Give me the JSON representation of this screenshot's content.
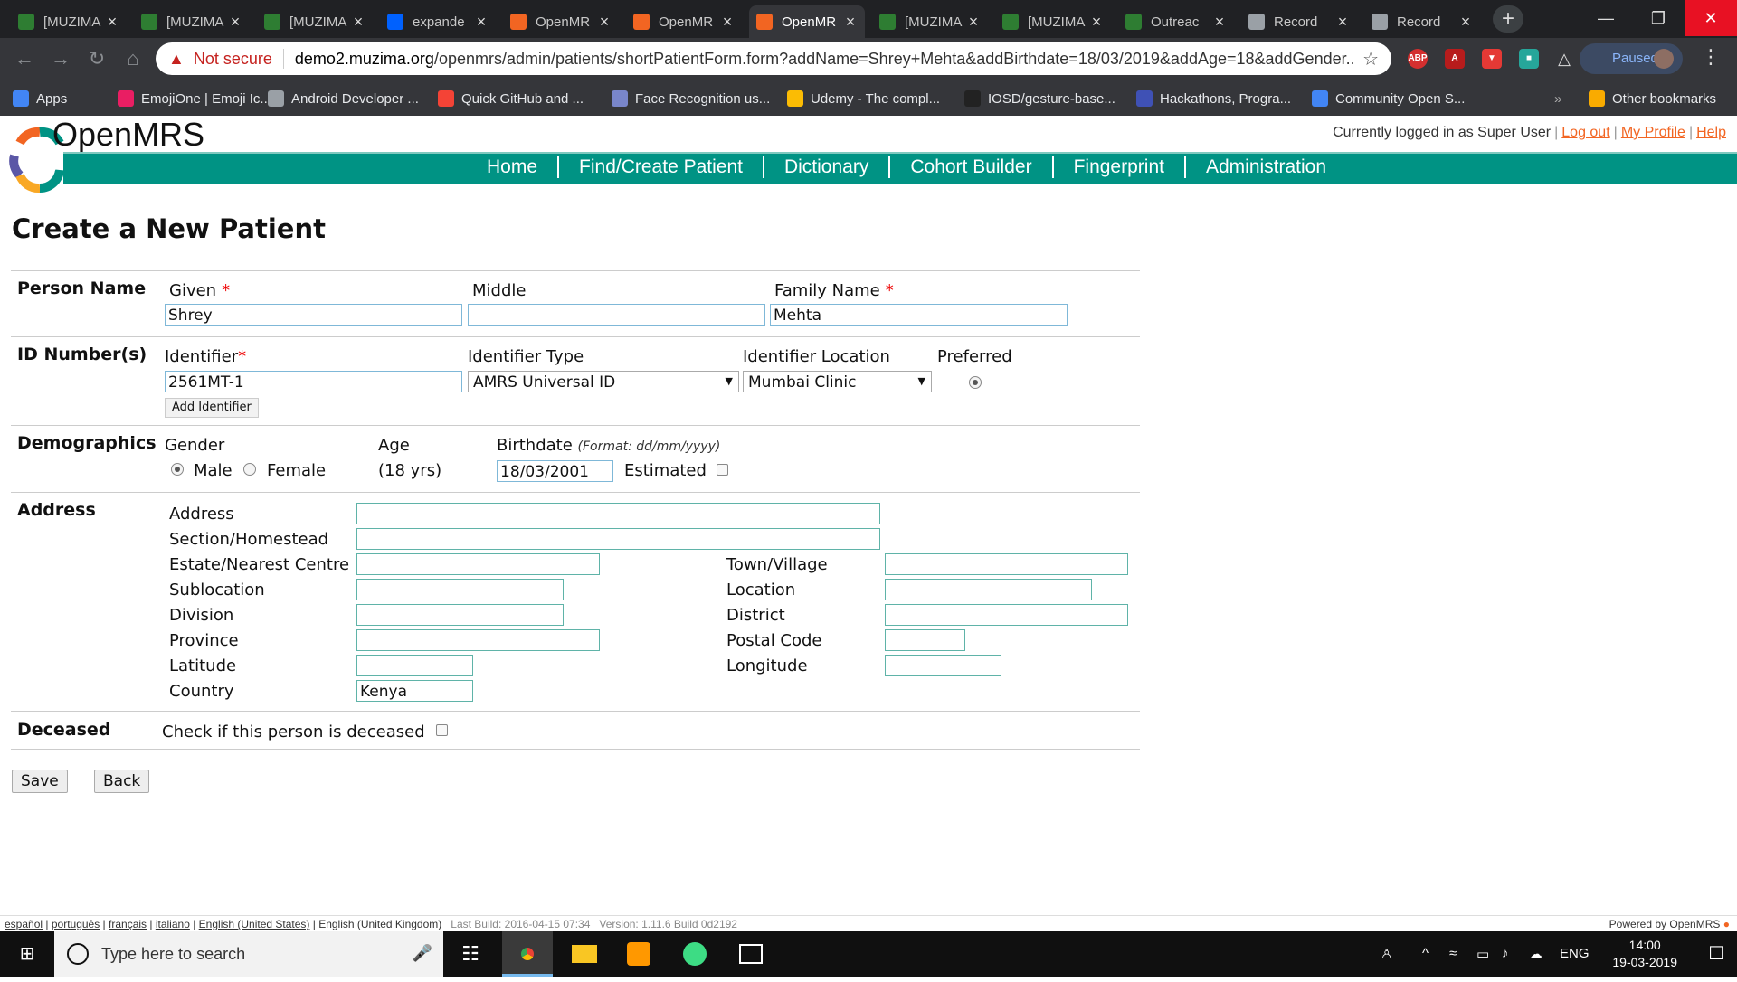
{
  "browser": {
    "tabs": [
      {
        "label": "[MUZIMA",
        "icon": "muzima-icon",
        "fav_color": "#2e7d32",
        "active": false
      },
      {
        "label": "[MUZIMA",
        "icon": "muzima-icon",
        "fav_color": "#2e7d32",
        "active": false
      },
      {
        "label": "[MUZIMA",
        "icon": "muzima-icon",
        "fav_color": "#2e7d32",
        "active": false
      },
      {
        "label": "expande",
        "icon": "dropbox-icon",
        "fav_color": "#0061fe",
        "active": false
      },
      {
        "label": "OpenMR",
        "icon": "openmrs-icon",
        "fav_color": "#f26522",
        "active": false
      },
      {
        "label": "OpenMR",
        "icon": "openmrs-icon",
        "fav_color": "#f26522",
        "active": false
      },
      {
        "label": "OpenMR",
        "icon": "loading-spinner-icon",
        "fav_color": "#f26522",
        "active": true
      },
      {
        "label": "[MUZIMA",
        "icon": "muzima-icon",
        "fav_color": "#2e7d32",
        "active": false
      },
      {
        "label": "[MUZIMA",
        "icon": "muzima-icon",
        "fav_color": "#2e7d32",
        "active": false
      },
      {
        "label": "Outreac",
        "icon": "muzima-icon",
        "fav_color": "#2e7d32",
        "active": false
      },
      {
        "label": "Record",
        "icon": "page-icon",
        "fav_color": "#9aa0a6",
        "active": false
      },
      {
        "label": "Record",
        "icon": "page-icon",
        "fav_color": "#9aa0a6",
        "active": false
      }
    ],
    "address": {
      "security": "Not secure",
      "domain": "demo2.muzima.org",
      "path": "/openmrs/admin/patients/shortPatientForm.form?addName=Shrey+Mehta&addBirthdate=18/03/2019&addAge=18&addGender..."
    },
    "profile_status": "Paused",
    "bookmarks": [
      {
        "label": "Apps",
        "icon": "apps-grid-icon",
        "color": "#4285f4"
      },
      {
        "label": "EmojiOne | Emoji Ic...",
        "icon": "unicorn-icon",
        "color": "#e91e63"
      },
      {
        "label": "Android Developer ...",
        "icon": "page-icon",
        "color": "#9aa0a6"
      },
      {
        "label": "Quick GitHub and ...",
        "icon": "bird-icon",
        "color": "#f44336"
      },
      {
        "label": "Face Recognition us...",
        "icon": "brain-icon",
        "color": "#7986cb"
      },
      {
        "label": "Udemy - The compl...",
        "icon": "drive-icon",
        "color": "#fbbc04"
      },
      {
        "label": "IOSD/gesture-base...",
        "icon": "github-icon",
        "color": "#222222"
      },
      {
        "label": "Hackathons, Progra...",
        "icon": "hackerearth-icon",
        "color": "#3f51b5"
      },
      {
        "label": "Community Open S...",
        "icon": "docs-icon",
        "color": "#4285f4"
      }
    ],
    "other_bookmarks": "Other bookmarks"
  },
  "header": {
    "logo_text": "OpenMRS",
    "logged_in_text": "Currently logged in as Super User",
    "logout": "Log out",
    "my_profile": "My Profile",
    "help": "Help",
    "nav": [
      "Home",
      "Find/Create Patient",
      "Dictionary",
      "Cohort Builder",
      "Fingerprint",
      "Administration"
    ],
    "brand_color": "#009384",
    "accent_color": "#f26522"
  },
  "form": {
    "title": "Create a New Patient",
    "person_name": {
      "section": "Person Name",
      "given_label": "Given",
      "middle_label": "Middle",
      "family_label": "Family Name",
      "given_value": "Shrey",
      "middle_value": "",
      "family_value": "Mehta"
    },
    "id_numbers": {
      "section": "ID Number(s)",
      "identifier_label": "Identifier",
      "identifier_value": "2561MT-1",
      "type_label": "Identifier Type",
      "type_value": "AMRS Universal ID",
      "location_label": "Identifier Location",
      "location_value": "Mumbai Clinic",
      "preferred_label": "Preferred",
      "add_identifier": "Add Identifier"
    },
    "demographics": {
      "section": "Demographics",
      "gender_label": "Gender",
      "male": "Male",
      "female": "Female",
      "age_label": "Age",
      "age_value": "(18 yrs)",
      "birthdate_label": "Birthdate",
      "birthdate_format": "(Format: dd/mm/yyyy)",
      "birthdate_value": "18/03/2001",
      "estimated_label": "Estimated"
    },
    "address": {
      "section": "Address",
      "address": "Address",
      "section_homestead": "Section/Homestead",
      "estate": "Estate/Nearest Centre",
      "sublocation": "Sublocation",
      "division": "Division",
      "province": "Province",
      "latitude": "Latitude",
      "country": "Country",
      "country_value": "Kenya",
      "town": "Town/Village",
      "location": "Location",
      "district": "District",
      "postal_code": "Postal Code",
      "longitude": "Longitude"
    },
    "deceased": {
      "section": "Deceased",
      "check_label": "Check if this person is deceased"
    },
    "save": "Save",
    "back": "Back"
  },
  "footer": {
    "languages": [
      "español",
      "português",
      "français",
      "italiano",
      "English (United States)"
    ],
    "current_language": "English (United Kingdom)",
    "build": "Last Build: 2016-04-15 07:34",
    "version": "Version: 1.11.6 Build 0d2192",
    "powered_by": "Powered by OpenMRS"
  },
  "taskbar": {
    "search_placeholder": "Type here to search",
    "language": "ENG",
    "time": "14:00",
    "date": "19-03-2019"
  }
}
